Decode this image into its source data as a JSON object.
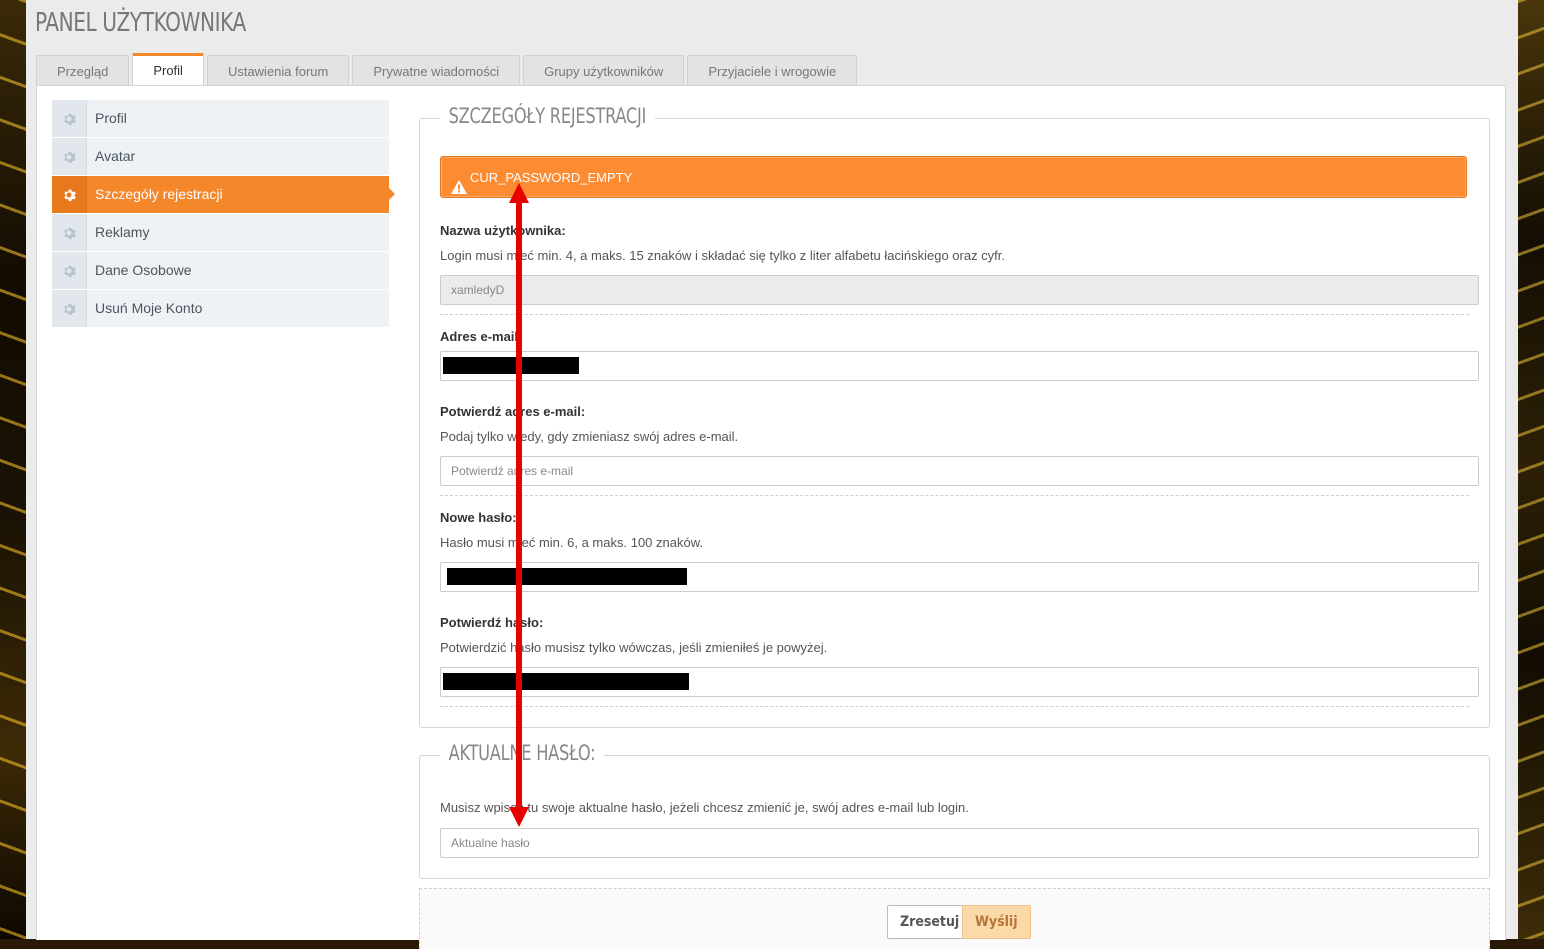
{
  "page_title": "PANEL UŻYTKOWNIKA",
  "tabs": [
    "Przegląd",
    "Profil",
    "Ustawienia forum",
    "Prywatne wiadomości",
    "Grupy użytkowników",
    "Przyjaciele i wrogowie"
  ],
  "sidebar": {
    "items": [
      {
        "label": "Profil"
      },
      {
        "label": "Avatar"
      },
      {
        "label": "Szczegóły rejestracji"
      },
      {
        "label": "Reklamy"
      },
      {
        "label": "Dane Osobowe"
      },
      {
        "label": "Usuń Moje Konto"
      }
    ]
  },
  "registration": {
    "legend": "SZCZEGÓŁY REJESTRACJI",
    "alert": "CUR_PASSWORD_EMPTY",
    "username": {
      "label": "Nazwa użytkownika:",
      "help": "Login musi mieć min. 4, a maks. 15 znaków i składać się tylko z liter alfabetu łacińskiego oraz cyfr.",
      "value": "xamledyD"
    },
    "email": {
      "label": "Adres e-mail:"
    },
    "email_confirm": {
      "label": "Potwierdź adres e-mail:",
      "help": "Podaj tylko wtedy, gdy zmieniasz swój adres e-mail.",
      "placeholder": "Potwierdź adres e-mail"
    },
    "new_password": {
      "label": "Nowe hasło:",
      "help": "Hasło musi mieć min. 6, a maks. 100 znaków."
    },
    "confirm_password": {
      "label": "Potwierdź hasło:",
      "help": "Potwierdzić hasło musisz tylko wówczas, jeśli zmieniłeś je powyżej."
    }
  },
  "current_password": {
    "legend": "AKTUALNE HASŁO:",
    "help": "Musisz wpisać tu swoje aktualne hasło, jeżeli chcesz zmienić je, swój adres e-mail lub login.",
    "placeholder": "Aktualne hasło"
  },
  "buttons": {
    "reset": "Zresetuj",
    "submit": "Wyślij"
  },
  "colors": {
    "accent": "#f5872b",
    "alert_bg": "#fd8b32",
    "annotation": "#e60000"
  }
}
